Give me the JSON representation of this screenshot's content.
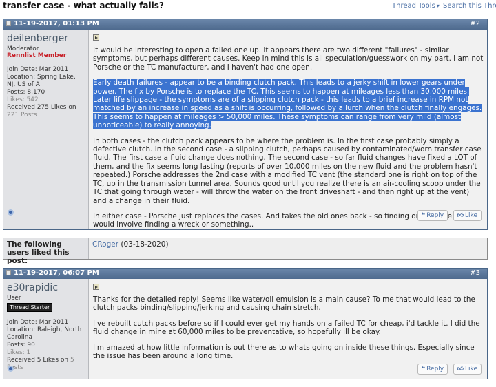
{
  "thread": {
    "title": "transfer case - what actually fails?",
    "tools_label": "Thread Tools",
    "search_label": "Search this Thread"
  },
  "posts": [
    {
      "date": "11-19-2017, 01:13 PM",
      "number": "#2",
      "user": {
        "name": "deilenberger",
        "title": "Moderator",
        "rank": "Rennlist Member",
        "join_date": "Join Date: Mar 2011",
        "location": "Location: Spring Lake, NJ, US of A",
        "posts": "Posts: 8,170",
        "likes": "Likes: 542",
        "received_prefix": "Received 275 Likes on",
        "received_posts": "221 Posts"
      },
      "paragraphs": {
        "p1": "It would be interesting to open a failed one up. It appears there are two different \"failures\" - similar symptoms, but perhaps different causes. Keep in mind this is all speculation/guesswork on my part. I am not Porsche or the TC manufacturer, and I haven't had one open.",
        "p2a": "Early death failures - appear to be a binding clutch pack. This leads to a jerky shift in lower gears under power. The fix by Porsche is to replace the TC. This seems to happen at mileages less than 30,000 miles.",
        "p2b": "Later life slippage - the symptoms are of a slipping clutch pack - this leads to a brief increase in RPM not matched by an increase in speed as a shift is occurring, followed by a lurch when the clutch finally engages. This seems to happen at mileages > 50,000 miles. These symptoms can range from very mild (almost unnoticeable) to really annoying.",
        "p3": "In both cases - the clutch pack appears to be where the problem is. In the first case probably simply a defective clutch. In the second case - a slipping clutch, perhaps caused by contaminated/worn transfer case fluid. The first case a fluid change does nothing. The second case - so far fluid changes have fixed a LOT of them, and the fix seems long lasting (reports of over 10,000 miles on the new fluid and the problem hasn't repeated.) Porsche addresses the 2nd case with a modified TC vent (the standard one is right on top of the TC, up in the transmission tunnel area. Sounds good until you realize there is an air-cooling scoop under the TC that going through water - will throw the water on the front driveshaft - and then right up at the vent) and a change in their fluid.",
        "p4": "In either case - Porsche just replaces the cases. And takes the old ones back - so finding one to take apart would involve finding a wreck or something.."
      }
    },
    {
      "date": "11-19-2017, 06:07 PM",
      "number": "#3",
      "user": {
        "name": "e30rapidic",
        "title": "User",
        "badge": "Thread Starter",
        "join_date": "Join Date: Mar 2011",
        "location": "Location: Raleigh, North Carolina",
        "posts": "Posts: 90",
        "likes": "Likes: 1",
        "received_prefix": "Received 5 Likes on",
        "received_posts": "5 Posts"
      },
      "paragraphs": {
        "p1": "Thanks for the detailed reply! Seems like water/oil emulsion is a main cause? To me that would lead to the clutch packs binding/slipping/jerking and causing chain stretch.",
        "p2": "I've rebuilt cutch packs before so if I could ever get my hands on a failed TC for cheap, i'd tackle it. I did the fluid change in mine at 60,000 miles to be preventative, so hopefully ill be okay.",
        "p3": "I'm amazed at how little information is out there as to whats going on inside these things. Especially since the issue has been around a long time."
      }
    }
  ],
  "buttons": {
    "reply": "Reply",
    "like": "Like"
  },
  "thanks": {
    "label": "The following users liked this post:",
    "user": "CRoger",
    "date": "(03-18-2020)"
  }
}
